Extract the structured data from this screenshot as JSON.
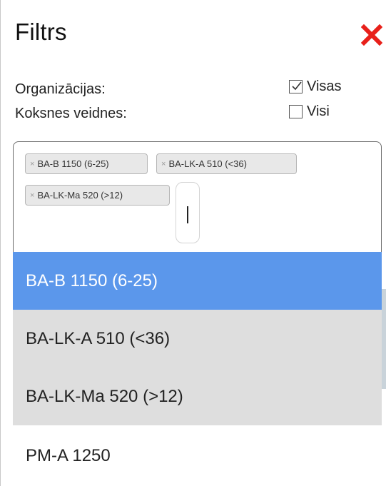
{
  "panel": {
    "title": "Filtrs",
    "close_icon": "close-x-icon",
    "close_color": "#e8201a"
  },
  "filters": {
    "organizations_label": "Organizācijas:",
    "species_label": "Koksnes veidnes:",
    "visas_label": "Visas",
    "visas_checked": true,
    "visi_label": "Visi",
    "visi_checked": false
  },
  "select": {
    "chip_remove_symbol": "×",
    "selected": [
      {
        "label": "BA-B 1150 (6-25)"
      },
      {
        "label": "BA-LK-A 510 (<36)"
      },
      {
        "label": "BA-LK-Ma 520 (>12)"
      }
    ],
    "search_value": ""
  },
  "dropdown": {
    "options": [
      {
        "label": "BA-B 1150 (6-25)",
        "state": "highlighted"
      },
      {
        "label": "BA-LK-A 510 (<36)",
        "state": "selected"
      },
      {
        "label": "BA-LK-Ma 520 (>12)",
        "state": "selected"
      },
      {
        "label": "PM-A 1250",
        "state": "normal"
      }
    ],
    "highlight_color": "#5b97eb",
    "selected_color": "#dedede"
  }
}
